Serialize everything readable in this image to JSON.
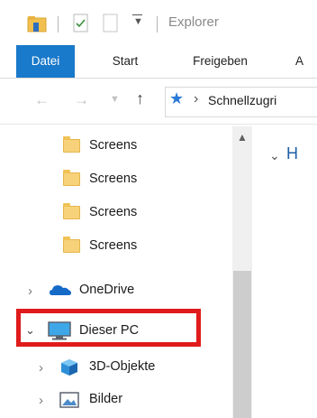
{
  "window": {
    "title": "Explorer"
  },
  "ribbon": {
    "tabs": [
      "Datei",
      "Start",
      "Freigeben",
      "A"
    ],
    "active_tab": "Datei"
  },
  "address": {
    "path": "Schnellzugri"
  },
  "content": {
    "heading": "H"
  },
  "nav": {
    "items": [
      {
        "label": "Screens",
        "icon": "folder-icon"
      },
      {
        "label": "Screens",
        "icon": "folder-icon"
      },
      {
        "label": "Screens",
        "icon": "folder-icon"
      },
      {
        "label": "Screens",
        "icon": "folder-icon"
      },
      {
        "label": "OneDrive",
        "icon": "onedrive-icon",
        "expander": "collapsed"
      },
      {
        "label": "Dieser PC",
        "icon": "pc-icon",
        "expander": "expanded",
        "highlighted": true
      },
      {
        "label": "3D-Objekte",
        "icon": "cube-icon",
        "expander": "collapsed"
      },
      {
        "label": "Bilder",
        "icon": "pictures-icon",
        "expander": "collapsed"
      }
    ]
  },
  "colors": {
    "accent": "#1979ca",
    "highlight": "#e01b1b",
    "folder": "#f7d27b"
  }
}
